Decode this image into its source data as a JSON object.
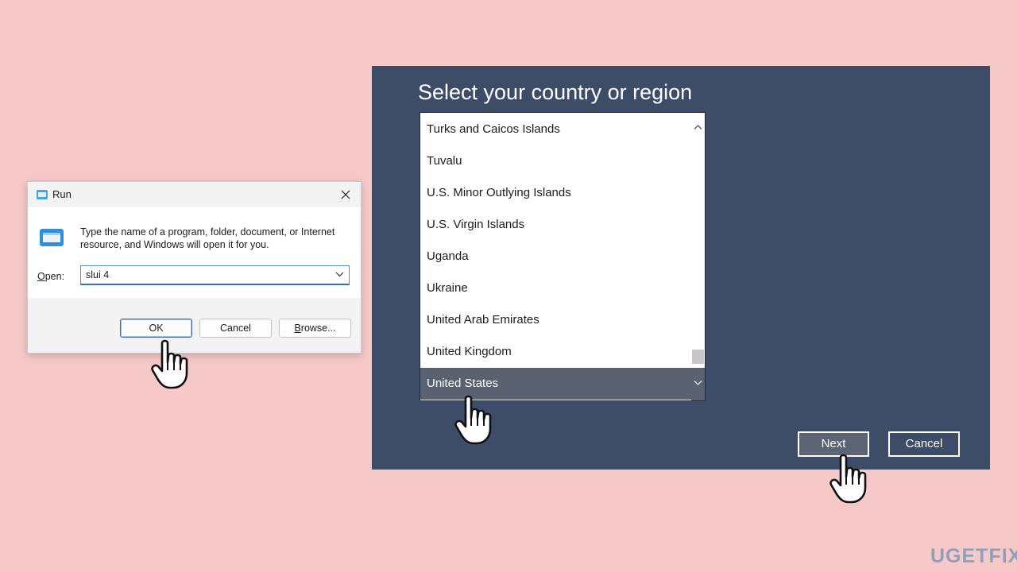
{
  "run_dialog": {
    "title": "Run",
    "description": "Type the name of a program, folder, document, or Internet resource, and Windows will open it for you.",
    "open_label_accel": "O",
    "open_label_rest": "pen:",
    "open_value": "slui 4",
    "ok_label": "OK",
    "cancel_label": "Cancel",
    "browse_accel": "B",
    "browse_rest": "rowse..."
  },
  "region_panel": {
    "heading": "Select your country or region",
    "countries": [
      "Turks and Caicos Islands",
      "Tuvalu",
      "U.S. Minor Outlying Islands",
      "U.S. Virgin Islands",
      "Uganda",
      "Ukraine",
      "United Arab Emirates",
      "United Kingdom",
      "United States"
    ],
    "selected": "United States",
    "next_label": "Next",
    "cancel_label": "Cancel"
  },
  "watermark": "UGETFIX",
  "icons": {
    "run_title": "run-icon",
    "close": "close-icon",
    "run_app": "run-app-icon",
    "combo_arrow": "chevron-down-icon",
    "scroll_up": "chevron-up-icon",
    "scroll_down": "chevron-down-icon",
    "pointer": "hand-pointer-icon"
  },
  "colors": {
    "background": "#f7c8c8",
    "panel": "#3d4c67",
    "selection": "#5a6170",
    "accent": "#2f6fbf"
  }
}
